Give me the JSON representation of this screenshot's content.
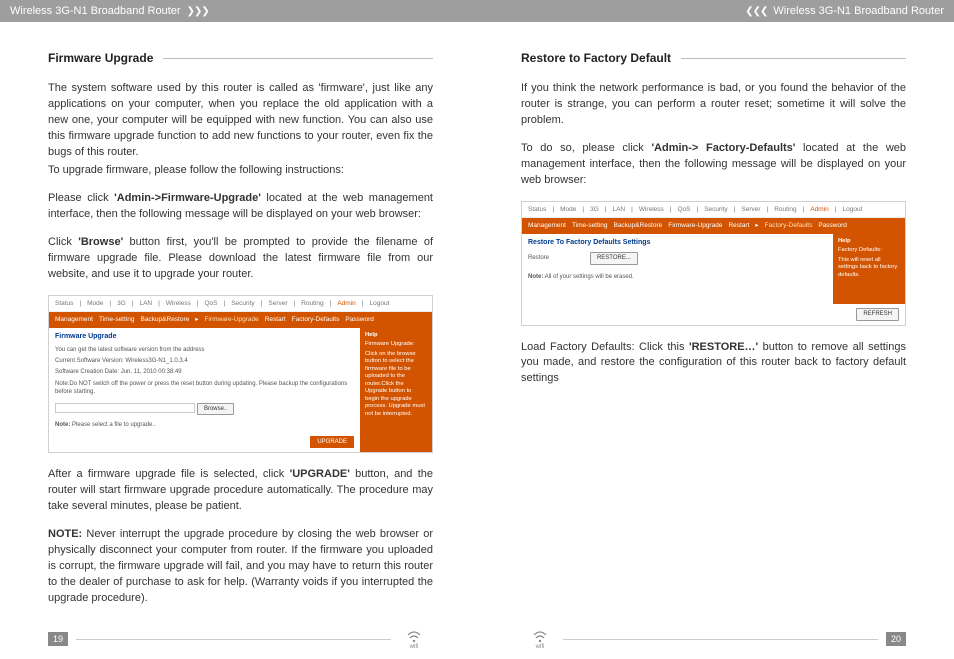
{
  "header": {
    "title": "Wireless 3G-N1 Broadband Router"
  },
  "left": {
    "section_title": "Firmware Upgrade",
    "p1": "The system software used by this router is called as 'firmware', just like any applications on your computer, when you replace the old application with a new one, your computer will be equipped with new function. You can also use this firmware upgrade function to add new functions to your router, even fix the bugs of this router.",
    "p2": "To upgrade firmware, please follow the following instructions:",
    "p3a": "Please click ",
    "p3b": "'Admin->Firmware-Upgrade'",
    "p3c": " located at the web management interface, then the following message will be displayed on your web browser:",
    "p4a": "Click ",
    "p4b": "'Browse'",
    "p4c": " button first, you'll be prompted to provide the filename of firmware upgrade file. Please download the latest firmware file from our website, and use it to upgrade your router.",
    "p5a": "After a firmware upgrade file is selected, click ",
    "p5b": "'UPGRADE'",
    "p5c": " button, and the router will start firmware upgrade procedure automatically. The procedure may take several minutes, please be patient.",
    "note_label": "NOTE:",
    "note_text": " Never interrupt the upgrade procedure by closing the web browser or physically disconnect your computer from router. If the firmware you uploaded is corrupt, the firmware upgrade will fail, and you may have to return this router to the dealer of purchase to ask for help. (Warranty voids if you interrupted the upgrade procedure).",
    "page_num": "19"
  },
  "right": {
    "section_title": "Restore to Factory Default",
    "p1": "If you think the network performance is bad, or you found the behavior of the router is strange, you can perform a router reset; sometime it will solve the problem.",
    "p2a": "To do so, please click ",
    "p2b": "'Admin-> Factory-Defaults'",
    "p2c": " located at the web management interface, then the following message will be displayed on your web browser:",
    "p3a": "Load Factory Defaults: Click this ",
    "p3b": "'RESTORE…'",
    "p3c": " button to remove all settings you made, and restore the configuration of this router back to factory default settings",
    "page_num": "20"
  },
  "ss_fw": {
    "top": [
      "Status",
      "Mode",
      "3G",
      "LAN",
      "Wireless",
      "QoS",
      "Security",
      "Server",
      "Routing"
    ],
    "top_admin": "Admin",
    "top_logout": "Logout",
    "nav": [
      "Management",
      "Time-setting",
      "Backup&Restore"
    ],
    "nav_active": "Firmware-Upgrade",
    "nav_rest": [
      "Restart",
      "Factory-Defaults",
      "Password"
    ],
    "heading": "Firmware Upgrade",
    "line1": "You can get the latest software version from the address",
    "line2": "Current Software Version: Wireless3G-N1_1.0.3.4",
    "line3": "Software Creation Date: Jun. 11, 2010 00:38:49",
    "line4": "Note:Do NOT switch off the power or press the reset button during updating. Please backup the configurations before starting.",
    "browse": "Browse..",
    "note2_label": "Note:",
    "note2": " Please select a file to upgrade..",
    "upgrade_btn": "UPGRADE",
    "help_title": "Help",
    "help_sub": "Firmware Upgrade:",
    "help_text": "Click on the browse button to select the firmware file to be uploaded to the router.Click the Upgrade button to begin the upgrade process. Upgrade must not be interrupted."
  },
  "ss_rd": {
    "top": [
      "Status",
      "Mode",
      "3G",
      "LAN",
      "Wireless",
      "QoS",
      "Security",
      "Server",
      "Routing"
    ],
    "top_admin": "Admin",
    "top_logout": "Logout",
    "nav": [
      "Management",
      "Time-setting",
      "Backup&Restore",
      "Firmware-Upgrade",
      "Restart"
    ],
    "nav_active": "Factory-Defaults",
    "nav_rest": [
      "Password"
    ],
    "heading": "Restore To Factory Defaults Settings",
    "line1": "Restore",
    "restore_btn": "RESTORE...",
    "note_label": "Note:",
    "note": " All of your settings will be erased.",
    "help_title": "Help",
    "help_sub": "Factory Defaults:",
    "help_text": "This will reset all settings back to factory defaults.",
    "refresh_btn": "REFRESH"
  },
  "footer": {
    "wifi_label": "wifi"
  }
}
